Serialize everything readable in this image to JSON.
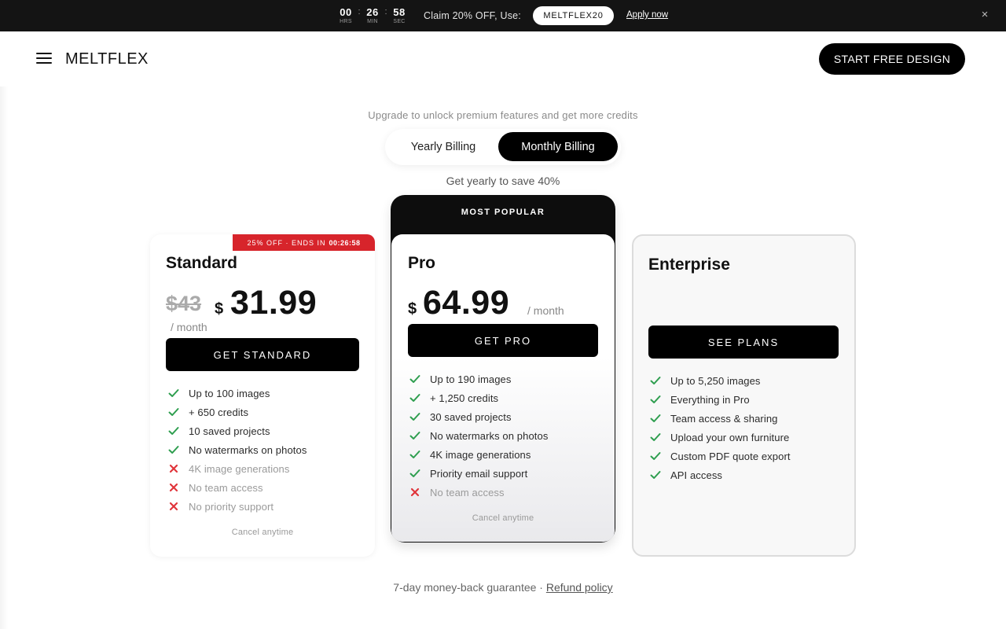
{
  "promo": {
    "timer": [
      {
        "value": "00",
        "label": "HRS"
      },
      {
        "value": "26",
        "label": "MIN"
      },
      {
        "value": "58",
        "label": "SEC"
      }
    ],
    "separator": ":",
    "text": "Claim 20% OFF, Use:",
    "code": "MELTFLEX20",
    "apply_label": "Apply now",
    "close_icon": "×"
  },
  "header": {
    "brand": "MELTFLEX",
    "cta_label": "START FREE DESIGN"
  },
  "intro": {
    "subtitle": "Upgrade to unlock premium features and get more credits",
    "toggle": {
      "yearly": "Yearly Billing",
      "monthly": "Monthly Billing",
      "active": "monthly"
    },
    "save_note": "Get yearly to save 40%"
  },
  "plans": {
    "standard": {
      "badge_text": "25% OFF · ENDS IN",
      "badge_timer": "00:26:58",
      "name": "Standard",
      "old_price": "$43",
      "currency": "$",
      "price": "31.99",
      "period": "/ month",
      "button": "GET STANDARD",
      "features": [
        {
          "text": "Up to 100 images",
          "included": true
        },
        {
          "text": "+ 650 credits",
          "included": true
        },
        {
          "text": "10 saved projects",
          "included": true
        },
        {
          "text": "No watermarks on photos",
          "included": true
        },
        {
          "text": "4K image generations",
          "included": false
        },
        {
          "text": "No team access",
          "included": false
        },
        {
          "text": "No priority support",
          "included": false
        }
      ],
      "cancel_note": "Cancel anytime"
    },
    "pro": {
      "banner": "MOST POPULAR",
      "name": "Pro",
      "currency": "$",
      "price": "64.99",
      "period": "/ month",
      "button": "GET PRO",
      "features": [
        {
          "text": "Up to 190 images",
          "included": true
        },
        {
          "text": "+ 1,250 credits",
          "included": true
        },
        {
          "text": "30 saved projects",
          "included": true
        },
        {
          "text": "No watermarks on photos",
          "included": true
        },
        {
          "text": "4K image generations",
          "included": true
        },
        {
          "text": "Priority email support",
          "included": true
        },
        {
          "text": "No team access",
          "included": false
        }
      ],
      "cancel_note": "Cancel anytime"
    },
    "enterprise": {
      "name": "Enterprise",
      "button": "SEE PLANS",
      "features": [
        {
          "text": "Up to 5,250 images",
          "included": true
        },
        {
          "text": "Everything in Pro",
          "included": true
        },
        {
          "text": "Team access & sharing",
          "included": true
        },
        {
          "text": "Upload your own furniture",
          "included": true
        },
        {
          "text": "Custom PDF quote export",
          "included": true
        },
        {
          "text": "API access",
          "included": true
        }
      ]
    }
  },
  "footer": {
    "guarantee": "7-day money-back guarantee ·",
    "refund_link": "Refund policy"
  },
  "colors": {
    "check": "#2e9e4f",
    "cross": "#e0353b",
    "badge": "#d7242b",
    "accent": "#000000"
  }
}
